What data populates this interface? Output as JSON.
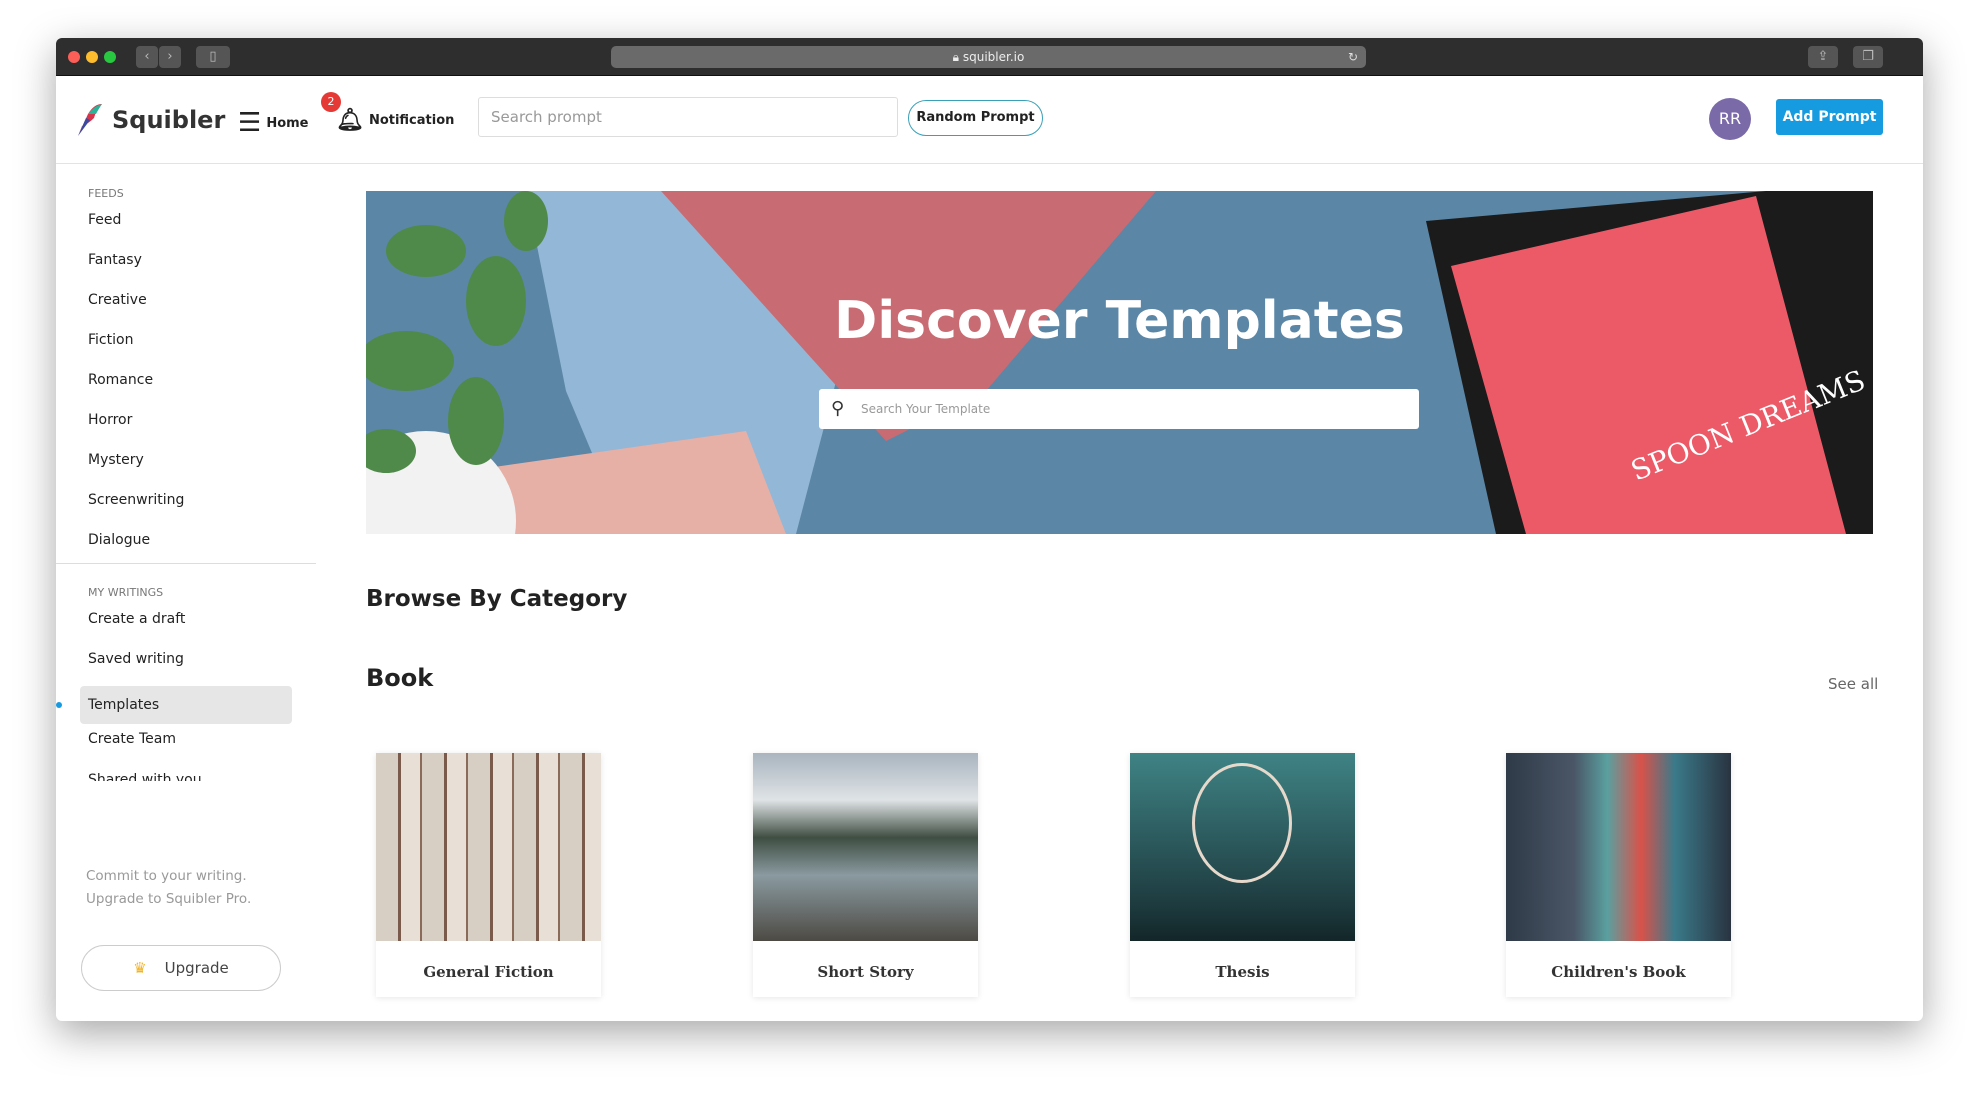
{
  "browser": {
    "url": "squibler.io"
  },
  "header": {
    "brand": "Squibler",
    "home": "Home",
    "notification": "Notification",
    "notification_count": "2",
    "search_placeholder": "Search prompt",
    "random_prompt": "Random Prompt",
    "avatar_initials": "RR",
    "add_prompt": "Add Prompt"
  },
  "sidebar": {
    "feeds_heading": "FEEDS",
    "feeds": [
      "Feed",
      "Fantasy",
      "Creative",
      "Fiction",
      "Romance",
      "Horror",
      "Mystery",
      "Screenwriting",
      "Dialogue"
    ],
    "writings_heading": "MY WRITINGS",
    "writings": [
      "Create a draft",
      "Saved writing",
      "Templates",
      "Create Team",
      "Shared with you"
    ],
    "active": "Templates",
    "promo_line1": "Commit to your writing.",
    "promo_line2": "Upgrade to Squibler Pro.",
    "upgrade": "Upgrade"
  },
  "banner": {
    "title": "Discover Templates",
    "search_placeholder": "Search Your Template",
    "image_text": "SPOON DREAMS"
  },
  "main": {
    "browse_heading": "Browse By Category",
    "section": "Book",
    "see_all": "See all",
    "cards": [
      {
        "label": "General Fiction"
      },
      {
        "label": "Short Story"
      },
      {
        "label": "Thesis"
      },
      {
        "label": "Children's Book"
      }
    ]
  },
  "colors": {
    "accent": "#179be0",
    "avatar": "#7b6aa8",
    "badge": "#e53935"
  }
}
